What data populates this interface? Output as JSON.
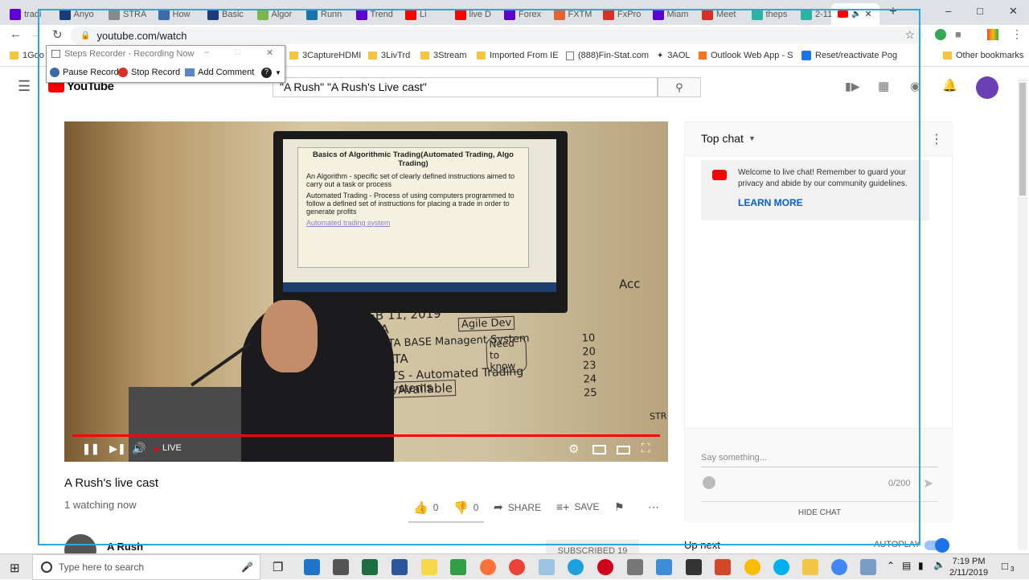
{
  "browser": {
    "tabs": [
      {
        "label": "tradi",
        "color": "#5f01d1"
      },
      {
        "label": "Anyo",
        "color": "#1a3d7a"
      },
      {
        "label": "STRA",
        "color": "#888888"
      },
      {
        "label": "How",
        "color": "#3d6aa8"
      },
      {
        "label": "Basic",
        "color": "#1a3d7a"
      },
      {
        "label": "Algor",
        "color": "#7ab648"
      },
      {
        "label": "Runn",
        "color": "#1a73a8"
      },
      {
        "label": "Trend",
        "color": "#5f01d1"
      },
      {
        "label": "Li",
        "color": "#ff0000"
      },
      {
        "label": "live D",
        "color": "#ff0000"
      },
      {
        "label": "Forex",
        "color": "#5f01d1"
      },
      {
        "label": "FXTM",
        "color": "#e8632b"
      },
      {
        "label": "FxPro",
        "color": "#d93025"
      },
      {
        "label": "Miam",
        "color": "#5f01d1"
      },
      {
        "label": "Meet",
        "color": "#d93025"
      },
      {
        "label": "theps",
        "color": "#2bb3a3"
      },
      {
        "label": "2-11-",
        "color": "#2bb3a3"
      }
    ],
    "active_tab_label": "",
    "new_tab": "+",
    "window_controls": {
      "minimize": "–",
      "maximize": "□",
      "close": "✕"
    },
    "url": "youtube.com/watch",
    "bookmarks": [
      {
        "label": "1Goo"
      },
      {
        "label": "3CaptureHDMI"
      },
      {
        "label": "3LivTrd"
      },
      {
        "label": "3Stream"
      },
      {
        "label": "Imported From IE"
      },
      {
        "label": "(888)Fin-Stat.com"
      },
      {
        "label": "3AOL"
      },
      {
        "label": "Outlook Web App - S"
      },
      {
        "label": "Reset/reactivate Pog"
      },
      {
        "label": "Other bookmarks"
      }
    ]
  },
  "steps_recorder": {
    "title": "Steps Recorder - Recording Now",
    "pause": "Pause Record",
    "stop": "Stop Record",
    "comment": "Add Comment",
    "help": "?"
  },
  "youtube": {
    "logo": "YouTube",
    "search_value": "\"A Rush\" \"A Rush's Live cast\"",
    "video": {
      "live_label": "LIVE",
      "slide_title": "Basics of Algorithmic Trading(Automated Trading, Algo Trading)",
      "slide_bullets": [
        "An Algorithm - specific set of clearly defined instructions aimed to carry out a task or process",
        "Automated Trading - Process of using computers programmed to follow a defined set of instructions for placing a trade in order to generate profits",
        "Automated trading system"
      ],
      "board_lines": [
        "MON FEB 11, 2019",
        "DATA",
        "DATA BASE Managent System",
        "BIG DATA",
        "ATS - Automated Trading Systems",
        "Quiz Available",
        "Agile Dev",
        "Need to know",
        "10 20 23 24 25",
        "Acc",
        "STR"
      ],
      "progress": 1.0
    },
    "title": "A Rush's live cast",
    "watching": "1 watching now",
    "likes": "0",
    "dislikes": "0",
    "share": "SHARE",
    "save": "SAVE",
    "channel": "A Rush",
    "subscribed": "SUBSCRIBED  19",
    "chat": {
      "header": "Top chat",
      "welcome": "Welcome to live chat! Remember to guard your privacy and abide by our community guidelines.",
      "learn_more": "LEARN MORE",
      "input_placeholder": "Say something...",
      "count": "0/200",
      "hide": "HIDE CHAT"
    },
    "up_next": "Up next",
    "autoplay": "AUTOPLAY"
  },
  "taskbar": {
    "search_placeholder": "Type here to search",
    "time": "7:19 PM",
    "date": "2/11/2019",
    "notification_count": "3"
  }
}
